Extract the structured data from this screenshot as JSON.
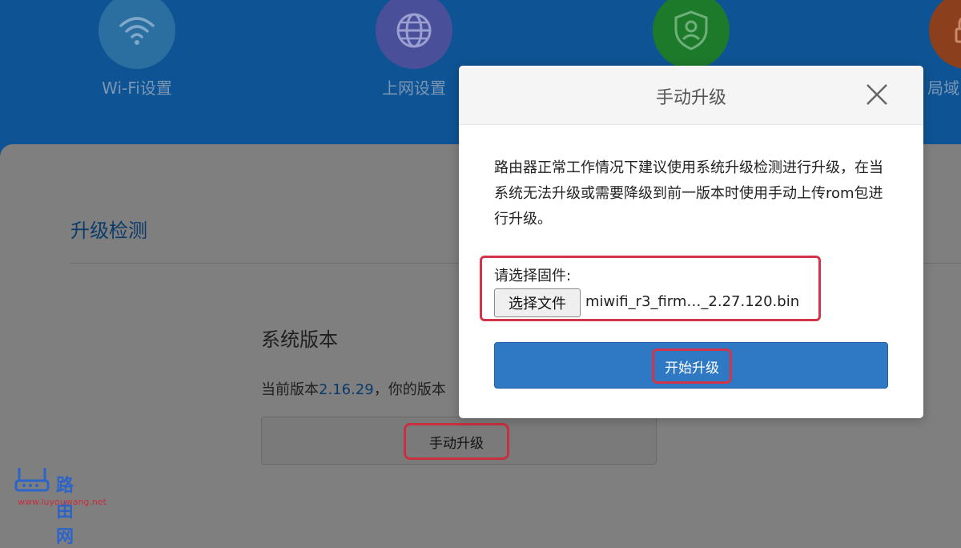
{
  "nav": {
    "items": [
      {
        "label": "Wi-Fi设置",
        "icon": "wifi-icon",
        "color": "#2b6ea0"
      },
      {
        "label": "上网设置",
        "icon": "globe-icon",
        "color": "#4a4f9a"
      },
      {
        "label": "",
        "icon": "shield-user-icon",
        "color": "#1d7a2b"
      },
      {
        "label": "局域",
        "icon": "lock-icon",
        "color": "#8b3f1c"
      }
    ]
  },
  "upgrade": {
    "section_title": "升级检测",
    "system_version_title": "系统版本",
    "current_version_prefix": "当前版本",
    "current_version": "2.16.29",
    "current_version_suffix": "，你的版本",
    "manual_upgrade_label": "手动升级"
  },
  "modal": {
    "title": "手动升级",
    "description": "路由器正常工作情况下建议使用系统升级检测进行升级，在当系统无法升级或需要降级到前一版本时使用手动上传rom包进行升级。",
    "file_label": "请选择固件:",
    "file_button": "选择文件",
    "file_name": "miwifi_r3_firm…_2.27.120.bin",
    "start_button": "开始升级"
  },
  "watermark": {
    "text": "路由网",
    "url": "www.luyouwang.net"
  },
  "colors": {
    "accent_blue": "#2f78c4",
    "highlight_red": "#d2344a"
  }
}
